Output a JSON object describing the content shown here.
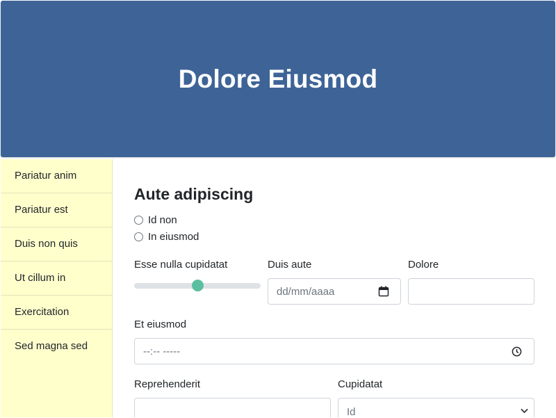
{
  "header": {
    "title": "Dolore Eiusmod"
  },
  "sidebar": {
    "items": [
      {
        "label": "Pariatur anim"
      },
      {
        "label": "Pariatur est"
      },
      {
        "label": "Duis non quis"
      },
      {
        "label": "Ut cillum in"
      },
      {
        "label": "Exercitation"
      },
      {
        "label": "Sed magna sed"
      }
    ]
  },
  "form": {
    "title": "Aute adipiscing",
    "radios": [
      {
        "label": "Id non",
        "checked": false
      },
      {
        "label": "In eiusmod",
        "checked": false
      }
    ],
    "range": {
      "label": "Esse nulla cupidatat",
      "value_fraction": 0.5
    },
    "date": {
      "label": "Duis aute",
      "placeholder": "dd/mm/aaaa"
    },
    "dolore": {
      "label": "Dolore",
      "value": ""
    },
    "time": {
      "label": "Et eiusmod",
      "placeholder": "--:-- -----"
    },
    "reprehenderit": {
      "label": "Reprehenderit",
      "value": ""
    },
    "select": {
      "label": "Cupidatat",
      "value": "Id"
    }
  },
  "colors": {
    "header_bg": "#3e6497",
    "sidebar_bg": "#ffffcc",
    "slider_thumb": "#5bbf9f"
  },
  "icons": {
    "date": "calendar-icon",
    "time": "clock-icon",
    "select": "chevron-down-icon"
  }
}
